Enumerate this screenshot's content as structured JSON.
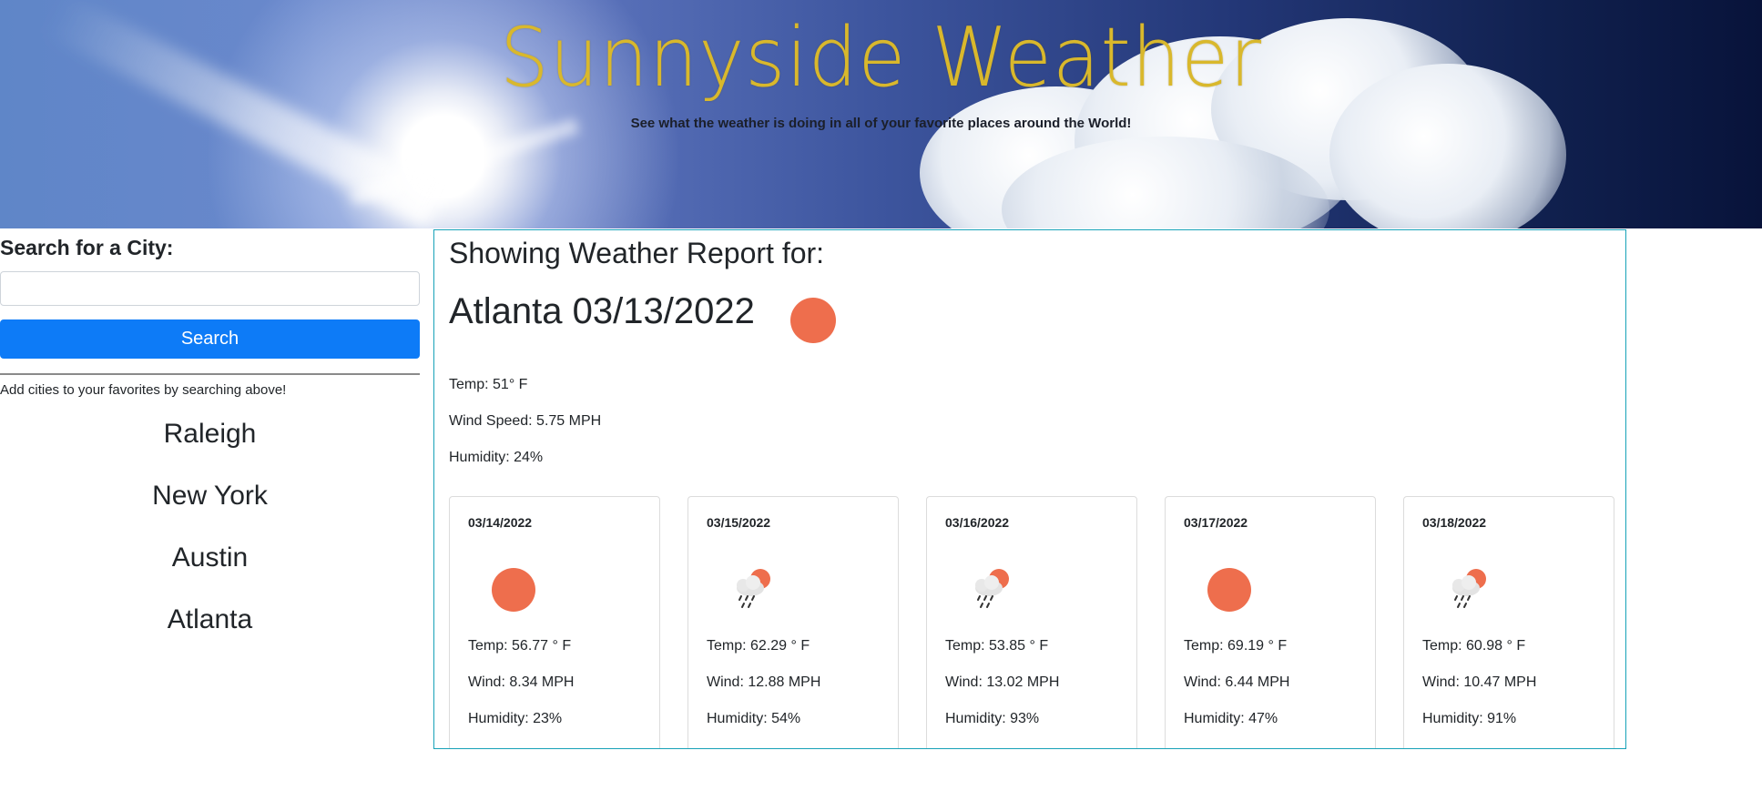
{
  "header": {
    "title": "Sunnyside Weather",
    "subtitle": "See what the weather is doing in all of your favorite places around the World!"
  },
  "sidebar": {
    "heading": "Search for a City:",
    "search_value": "",
    "search_placeholder": "",
    "search_button_label": "Search",
    "hint": "Add cities to your favorites by searching above!",
    "favorites": [
      "Raleigh",
      "New York",
      "Austin",
      "Atlanta"
    ]
  },
  "report": {
    "heading": "Showing Weather Report for:",
    "current": {
      "title": "Atlanta 03/13/2022",
      "icon": "sun-icon",
      "temp": "Temp: 51° F",
      "wind": "Wind Speed: 5.75 MPH",
      "humidity": "Humidity: 24%"
    },
    "forecast": [
      {
        "date": "03/14/2022",
        "icon": "sun-icon",
        "temp": "Temp: 56.77 ° F",
        "wind": "Wind: 8.34 MPH",
        "humidity": "Humidity: 23%"
      },
      {
        "date": "03/15/2022",
        "icon": "rain-cloud-sun-icon",
        "temp": "Temp: 62.29 ° F",
        "wind": "Wind: 12.88 MPH",
        "humidity": "Humidity: 54%"
      },
      {
        "date": "03/16/2022",
        "icon": "rain-cloud-sun-icon",
        "temp": "Temp: 53.85 ° F",
        "wind": "Wind: 13.02 MPH",
        "humidity": "Humidity: 93%"
      },
      {
        "date": "03/17/2022",
        "icon": "sun-icon",
        "temp": "Temp: 69.19 ° F",
        "wind": "Wind: 6.44 MPH",
        "humidity": "Humidity: 47%"
      },
      {
        "date": "03/18/2022",
        "icon": "rain-cloud-sun-icon",
        "temp": "Temp: 60.98 ° F",
        "wind": "Wind: 10.47 MPH",
        "humidity": "Humidity: 91%"
      }
    ]
  },
  "colors": {
    "title_gold": "#d9b82c",
    "button_blue": "#0d7bf7",
    "report_border": "#17a2b8",
    "sun_orange": "#ee6e4d"
  }
}
